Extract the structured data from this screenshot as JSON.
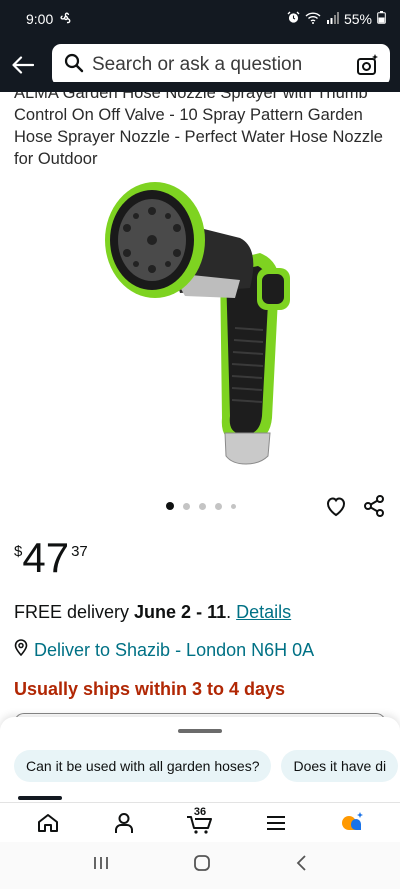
{
  "status_bar": {
    "time": "9:00",
    "battery": "55%"
  },
  "search": {
    "placeholder": "Search or ask a question"
  },
  "product": {
    "title": "ALMA Garden Hose Nozzle Sprayer with Thumb Control On Off Valve - 10 Spray Pattern Garden Hose Sprayer Nozzle - Perfect Water Hose Nozzle for Outdoor",
    "price_symbol": "$",
    "price_whole": "47",
    "price_fraction": "37",
    "image_count": 5,
    "active_image": 1
  },
  "delivery": {
    "prefix": "FREE delivery ",
    "dates": "June 2 - 11",
    "separator": ". ",
    "details_link": "Details",
    "deliver_to": "Deliver to Shazib - London N6H 0A",
    "ships": "Usually ships within 3 to 4 days"
  },
  "questions": {
    "chips": [
      "Can it be used with all garden hoses?",
      "Does it have di"
    ]
  },
  "bottom_nav": {
    "cart_count": "36"
  },
  "colors": {
    "header": "#131921",
    "link": "#007185",
    "ships": "#b12704",
    "chip_bg": "#e8f4f7"
  }
}
